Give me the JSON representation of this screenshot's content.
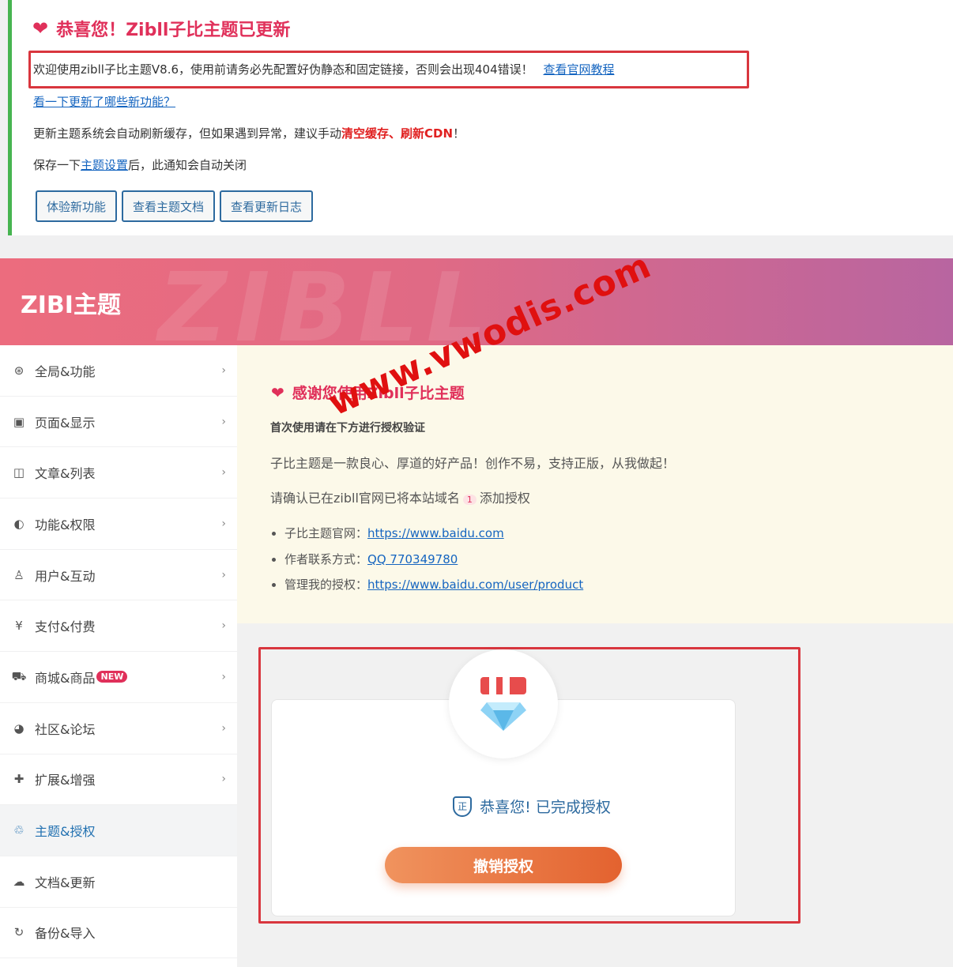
{
  "notice": {
    "title": "恭喜您！Zibll子比主题已更新",
    "welcome_text": "欢迎使用zibll子比主题V8.6，使用前请务必先配置好伪静态和固定链接，否则会出现404错误！",
    "welcome_link": "查看官网教程",
    "whats_new_link": "看一下更新了哪些新功能？",
    "cache_text_prefix": "更新主题系统会自动刷新缓存，但如果遇到异常，建议手动",
    "cache_clear": "清空缓存",
    "cache_sep": "、",
    "cache_cdn": "刷新CDN",
    "cache_suffix": "！",
    "save_prefix": "保存一下",
    "save_link": "主题设置",
    "save_suffix": "后，此通知会自动关闭",
    "buttons": [
      "体验新功能",
      "查看主题文档",
      "查看更新日志"
    ]
  },
  "banner": {
    "title": "ZIBI主题",
    "watermark": "ZIBLL"
  },
  "sidebar": {
    "items": [
      {
        "label": "全局&功能",
        "icon": "⊛"
      },
      {
        "label": "页面&显示",
        "icon": "▣"
      },
      {
        "label": "文章&列表",
        "icon": "◫"
      },
      {
        "label": "功能&权限",
        "icon": "◐"
      },
      {
        "label": "用户&互动",
        "icon": "♙"
      },
      {
        "label": "支付&付费",
        "icon": "¥"
      },
      {
        "label": "商城&商品",
        "icon": "⛟",
        "badge": "NEW"
      },
      {
        "label": "社区&论坛",
        "icon": "◕"
      },
      {
        "label": "扩展&增强",
        "icon": "✚"
      },
      {
        "label": "主题&授权",
        "icon": "♲"
      },
      {
        "label": "文档&更新",
        "icon": "☁"
      },
      {
        "label": "备份&导入",
        "icon": "↻"
      }
    ]
  },
  "info": {
    "title": "感谢您使用Zibll子比主题",
    "subtitle": "首次使用请在下方进行授权验证",
    "p1": "子比主题是一款良心、厚道的好产品！创作不易，支持正版，从我做起！",
    "p2_prefix": "请确认已在zibll官网已将本站域名",
    "p2_badge": "1",
    "p2_suffix": "添加授权",
    "links": [
      {
        "label": "子比主题官网：",
        "url": "https://www.baidu.com"
      },
      {
        "label": "作者联系方式：",
        "url": "QQ 770349780"
      },
      {
        "label": "管理我的授权：",
        "url": "https://www.baidu.com/user/product"
      }
    ]
  },
  "auth": {
    "message": "恭喜您! 已完成授权",
    "revoke_button": "撤销授权",
    "shield_char": "正"
  },
  "overlay_watermark": "www.vwodis.com",
  "colors": {
    "accent_red": "#e0305a",
    "link_blue": "#1565c0",
    "success_green": "#46b450",
    "button_orange": "#e3622f"
  }
}
